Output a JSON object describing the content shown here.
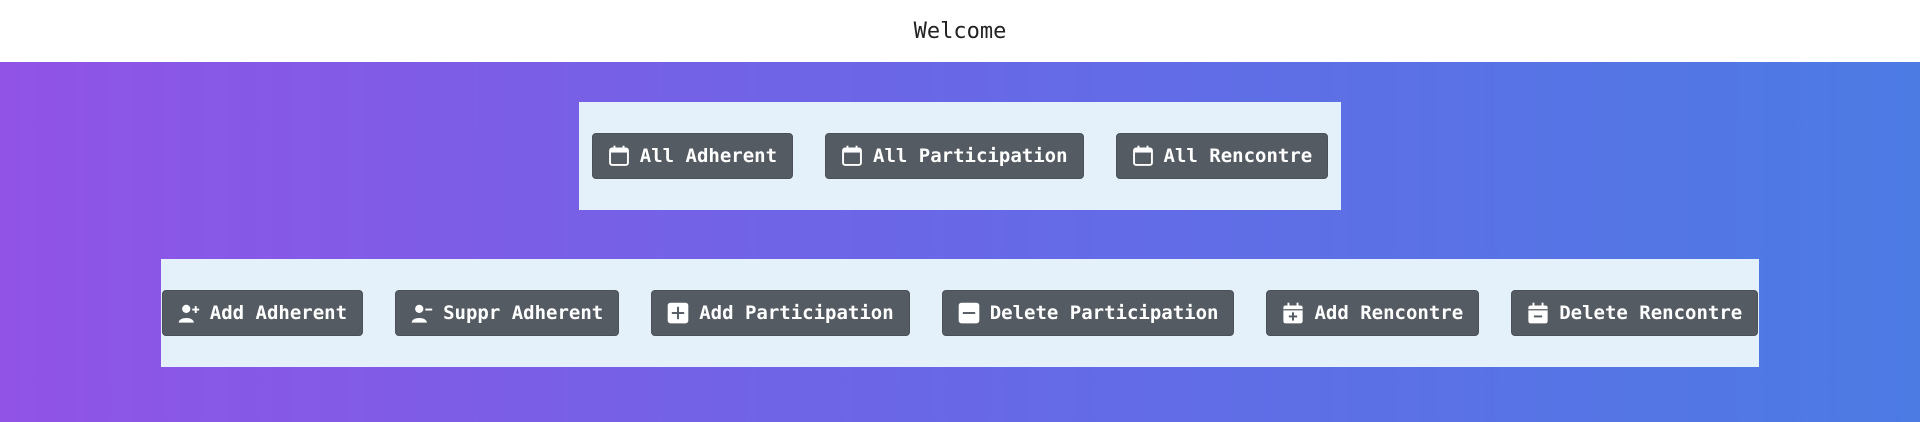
{
  "header": {
    "title": "Welcome"
  },
  "top_panel": {
    "buttons": [
      {
        "label": "All Adherent",
        "icon": "calendar-icon"
      },
      {
        "label": "All Participation",
        "icon": "calendar-icon"
      },
      {
        "label": "All Rencontre",
        "icon": "calendar-icon"
      }
    ]
  },
  "bottom_panel": {
    "buttons": [
      {
        "label": "Add Adherent",
        "icon": "user-plus-icon"
      },
      {
        "label": "Suppr Adherent",
        "icon": "user-minus-icon"
      },
      {
        "label": "Add Participation",
        "icon": "plus-square-icon"
      },
      {
        "label": "Delete Participation",
        "icon": "minus-square-icon"
      },
      {
        "label": "Add Rencontre",
        "icon": "calendar-plus-icon"
      },
      {
        "label": "Delete Rencontre",
        "icon": "calendar-minus-icon"
      }
    ]
  },
  "colors": {
    "gradient_start": "#9153e6",
    "gradient_end": "#4c7be4",
    "panel_bg": "#e4f1fb",
    "button_bg": "#545b62",
    "button_text": "#ffffff"
  }
}
